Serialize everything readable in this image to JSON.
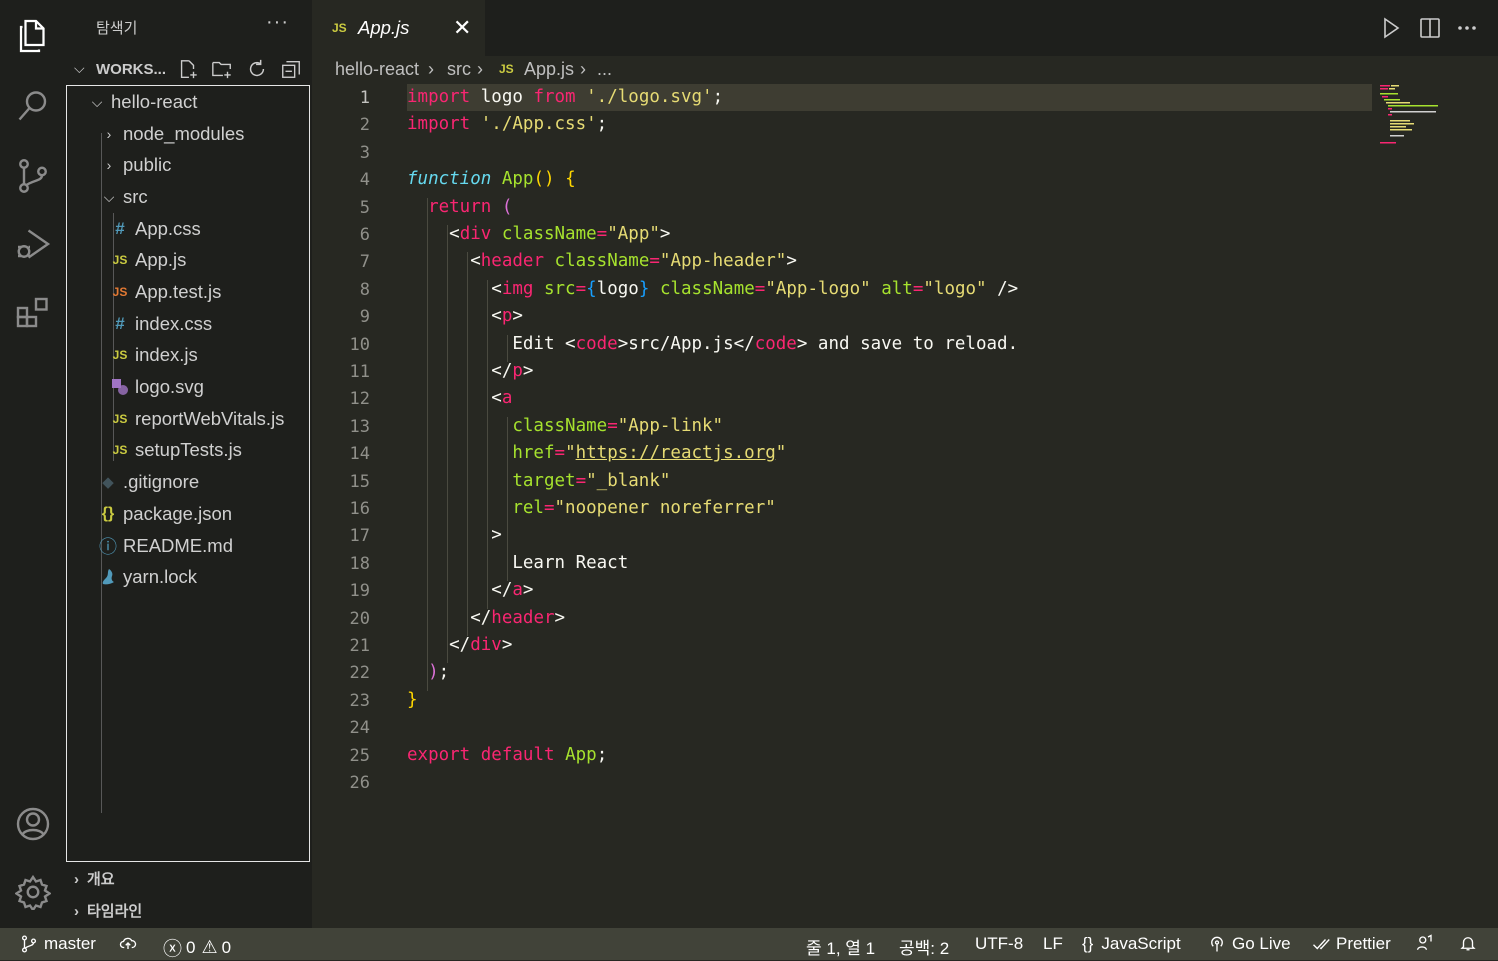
{
  "activity_bar": {
    "items": [
      "explorer-icon",
      "search-icon",
      "source-control-icon",
      "run-debug-icon",
      "extensions-icon"
    ],
    "bottom": [
      "account-icon",
      "settings-gear-icon"
    ]
  },
  "sidebar": {
    "title": "탐색기",
    "more": "···",
    "workspace_title": "WORKS...",
    "tree": [
      {
        "label": "hello-react",
        "type": "folder",
        "open": true,
        "depth": 0
      },
      {
        "label": "node_modules",
        "type": "folder",
        "open": false,
        "depth": 1
      },
      {
        "label": "public",
        "type": "folder",
        "open": false,
        "depth": 1
      },
      {
        "label": "src",
        "type": "folder",
        "open": true,
        "depth": 1
      },
      {
        "label": "App.css",
        "type": "css",
        "icon": "#",
        "depth": 2
      },
      {
        "label": "App.js",
        "type": "js",
        "icon": "JS",
        "depth": 2
      },
      {
        "label": "App.test.js",
        "type": "jstest",
        "icon": "JS",
        "depth": 2
      },
      {
        "label": "index.css",
        "type": "css",
        "icon": "#",
        "depth": 2
      },
      {
        "label": "index.js",
        "type": "js",
        "icon": "JS",
        "depth": 2
      },
      {
        "label": "logo.svg",
        "type": "svg",
        "icon": "",
        "depth": 2
      },
      {
        "label": "reportWebVitals.js",
        "type": "js",
        "icon": "JS",
        "depth": 2
      },
      {
        "label": "setupTests.js",
        "type": "js",
        "icon": "JS",
        "depth": 2
      },
      {
        "label": ".gitignore",
        "type": "git",
        "icon": "◆",
        "depth": 1
      },
      {
        "label": "package.json",
        "type": "json",
        "icon": "{}",
        "depth": 1
      },
      {
        "label": "README.md",
        "type": "info",
        "icon": "ⓘ",
        "depth": 1
      },
      {
        "label": "yarn.lock",
        "type": "yarn",
        "icon": "",
        "depth": 1
      }
    ],
    "sections": [
      "개요",
      "타임라인"
    ]
  },
  "tab": {
    "icon": "JS",
    "name": "App.js",
    "close": "✕"
  },
  "breadcrumb": {
    "parts": [
      "hello-react",
      "src",
      "App.js",
      "..."
    ],
    "sep": "›",
    "js": "JS"
  },
  "editor": {
    "lines": [
      [
        [
          "k",
          "import"
        ],
        [
          "p",
          " logo "
        ],
        [
          "k",
          "from"
        ],
        [
          "p",
          " "
        ],
        [
          "s",
          "'./logo.svg'"
        ],
        [
          "p",
          ";"
        ]
      ],
      [
        [
          "k",
          "import"
        ],
        [
          "p",
          " "
        ],
        [
          "s",
          "'./App.css'"
        ],
        [
          "p",
          ";"
        ]
      ],
      [],
      [
        [
          "b",
          "function"
        ],
        [
          "p",
          " "
        ],
        [
          "f",
          "App"
        ],
        [
          "y1",
          "()"
        ],
        [
          "p",
          " "
        ],
        [
          "y1",
          "{"
        ]
      ],
      [
        [
          "p",
          "  "
        ],
        [
          "k",
          "return"
        ],
        [
          "p",
          " "
        ],
        [
          "y2",
          "("
        ]
      ],
      [
        [
          "p",
          "    <"
        ],
        [
          "k",
          "div"
        ],
        [
          "p",
          " "
        ],
        [
          "a",
          "className"
        ],
        [
          "k",
          "="
        ],
        [
          "s",
          "\"App\""
        ],
        [
          "p",
          ">"
        ]
      ],
      [
        [
          "p",
          "      <"
        ],
        [
          "k",
          "header"
        ],
        [
          "p",
          " "
        ],
        [
          "a",
          "className"
        ],
        [
          "k",
          "="
        ],
        [
          "s",
          "\"App-header\""
        ],
        [
          "p",
          ">"
        ]
      ],
      [
        [
          "p",
          "        <"
        ],
        [
          "k",
          "img"
        ],
        [
          "p",
          " "
        ],
        [
          "a",
          "src"
        ],
        [
          "k",
          "="
        ],
        [
          "y3",
          "{"
        ],
        [
          "p",
          "logo"
        ],
        [
          "y3",
          "}"
        ],
        [
          "p",
          " "
        ],
        [
          "a",
          "className"
        ],
        [
          "k",
          "="
        ],
        [
          "s",
          "\"App-logo\""
        ],
        [
          "p",
          " "
        ],
        [
          "a",
          "alt"
        ],
        [
          "k",
          "="
        ],
        [
          "s",
          "\"logo\""
        ],
        [
          "p",
          " />"
        ]
      ],
      [
        [
          "p",
          "        <"
        ],
        [
          "k",
          "p"
        ],
        [
          "p",
          ">"
        ]
      ],
      [
        [
          "p",
          "          Edit <"
        ],
        [
          "k",
          "code"
        ],
        [
          "p",
          ">src/App.js</"
        ],
        [
          "k",
          "code"
        ],
        [
          "p",
          "> and save to reload."
        ]
      ],
      [
        [
          "p",
          "        </"
        ],
        [
          "k",
          "p"
        ],
        [
          "p",
          ">"
        ]
      ],
      [
        [
          "p",
          "        <"
        ],
        [
          "k",
          "a"
        ]
      ],
      [
        [
          "p",
          "          "
        ],
        [
          "a",
          "className"
        ],
        [
          "k",
          "="
        ],
        [
          "s",
          "\"App-link\""
        ]
      ],
      [
        [
          "p",
          "          "
        ],
        [
          "a",
          "href"
        ],
        [
          "k",
          "="
        ],
        [
          "s",
          "\""
        ],
        [
          "u",
          "https://reactjs.org"
        ],
        [
          "s",
          "\""
        ]
      ],
      [
        [
          "p",
          "          "
        ],
        [
          "a",
          "target"
        ],
        [
          "k",
          "="
        ],
        [
          "s",
          "\"_blank\""
        ]
      ],
      [
        [
          "p",
          "          "
        ],
        [
          "a",
          "rel"
        ],
        [
          "k",
          "="
        ],
        [
          "s",
          "\"noopener noreferrer\""
        ]
      ],
      [
        [
          "p",
          "        >"
        ]
      ],
      [
        [
          "p",
          "          Learn React"
        ]
      ],
      [
        [
          "p",
          "        </"
        ],
        [
          "k",
          "a"
        ],
        [
          "p",
          ">"
        ]
      ],
      [
        [
          "p",
          "      </"
        ],
        [
          "k",
          "header"
        ],
        [
          "p",
          ">"
        ]
      ],
      [
        [
          "p",
          "    </"
        ],
        [
          "k",
          "div"
        ],
        [
          "p",
          ">"
        ]
      ],
      [
        [
          "p",
          "  "
        ],
        [
          "y2",
          ")"
        ],
        [
          "p",
          ";"
        ]
      ],
      [
        [
          "y1",
          "}"
        ]
      ],
      [],
      [
        [
          "k",
          "export"
        ],
        [
          "p",
          " "
        ],
        [
          "k",
          "default"
        ],
        [
          "p",
          " "
        ],
        [
          "f",
          "App"
        ],
        [
          "p",
          ";"
        ]
      ],
      []
    ]
  },
  "status": {
    "branch": "master",
    "errors": "0",
    "warnings": "0",
    "position": "줄 1, 열 1",
    "spaces": "공백: 2",
    "encoding": "UTF-8",
    "eol": "LF",
    "language": "JavaScript",
    "golive": "Go Live",
    "prettier": "Prettier"
  },
  "colors": {
    "background": "#272822",
    "sidebar": "#1e1f1c",
    "statusbar": "#414339",
    "keyword": "#f92672",
    "string": "#e6db74",
    "function": "#a6e22e"
  }
}
